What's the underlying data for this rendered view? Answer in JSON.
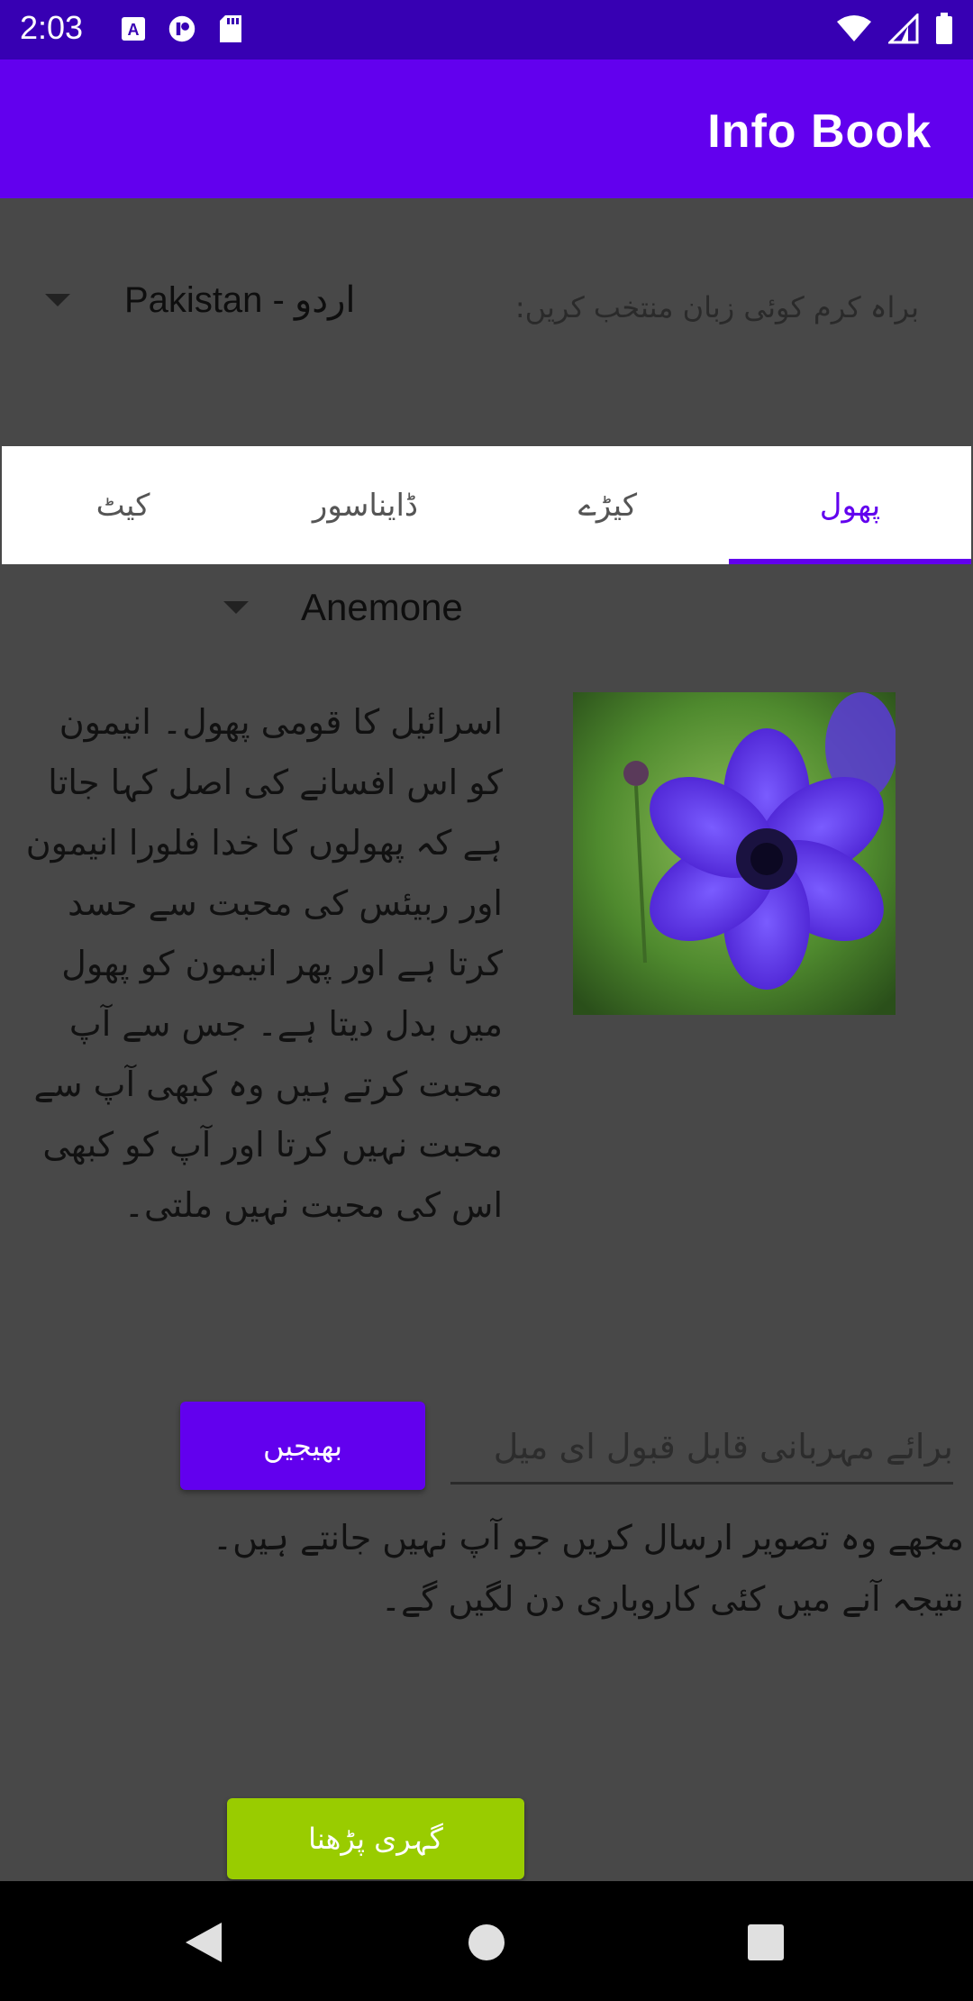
{
  "status_bar": {
    "time": "2:03"
  },
  "app_bar": {
    "title": "Info Book"
  },
  "language": {
    "prompt": "براہ کرم کوئی زبان منتخب کریں:",
    "selected": "Pakistan - اردو"
  },
  "tabs": [
    {
      "label": "پھول",
      "active": true
    },
    {
      "label": "کیڑے",
      "active": false
    },
    {
      "label": "ڈایناسور",
      "active": false
    },
    {
      "label": "کیٹ",
      "active": false
    }
  ],
  "item": {
    "selected": "Anemone"
  },
  "description": "اسرائیل کا قومی پھول۔ انیمون کو اس افسانے کی اصل کہا جاتا ہے کہ پھولوں کا خدا فلورا انیمون اور ربیئس کی محبت سے حسد کرتا ہے اور پھر انیمون کو پھول میں بدل دیتا ہے۔ جس سے آپ محبت کرتے ہیں وہ کبھی آپ سے محبت نہیں کرتا اور آپ کو کبھی اس کی محبت نہیں ملتی۔",
  "email": {
    "placeholder": "برائے مہربانی قابل قبول ای میل",
    "value": "",
    "send_label": "بھیجیں"
  },
  "notice": "مجھے وہ تصویر ارسال کریں جو آپ نہیں جانتے ہیں۔ نتیجہ آنے میں کئی کاروباری دن لگیں گے۔",
  "read_more_label": "گہری پڑھنا",
  "colors": {
    "primary": "#6200ee",
    "primary_dark": "#3700b3",
    "accent_green": "#99cc00",
    "background": "#484848"
  }
}
